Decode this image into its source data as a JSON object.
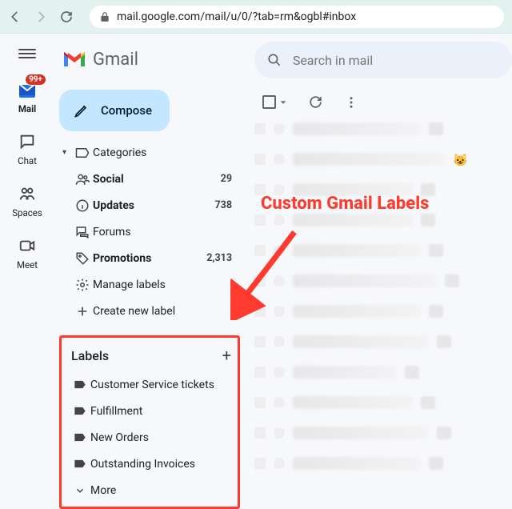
{
  "browser": {
    "url": "mail.google.com/mail/u/0/?tab=rm&ogbl#inbox"
  },
  "rail": {
    "mail": {
      "label": "Mail",
      "badge": "99+"
    },
    "chat": {
      "label": "Chat"
    },
    "spaces": {
      "label": "Spaces"
    },
    "meet": {
      "label": "Meet"
    }
  },
  "logo_text": "Gmail",
  "compose_label": "Compose",
  "search_placeholder": "Search in mail",
  "categories": {
    "header": "Categories",
    "social": {
      "label": "Social",
      "count": "29"
    },
    "updates": {
      "label": "Updates",
      "count": "738"
    },
    "forums": {
      "label": "Forums",
      "count": ""
    },
    "promotions": {
      "label": "Promotions",
      "count": "2,313"
    },
    "manage": {
      "label": "Manage labels"
    },
    "create": {
      "label": "Create new label"
    }
  },
  "labels": {
    "header": "Labels",
    "items": [
      {
        "label": "Customer Service tickets"
      },
      {
        "label": "Fulfillment"
      },
      {
        "label": "New Orders"
      },
      {
        "label": "Outstanding Invoices"
      }
    ],
    "more": "More"
  },
  "annotation_text": "Custom Gmail Labels"
}
